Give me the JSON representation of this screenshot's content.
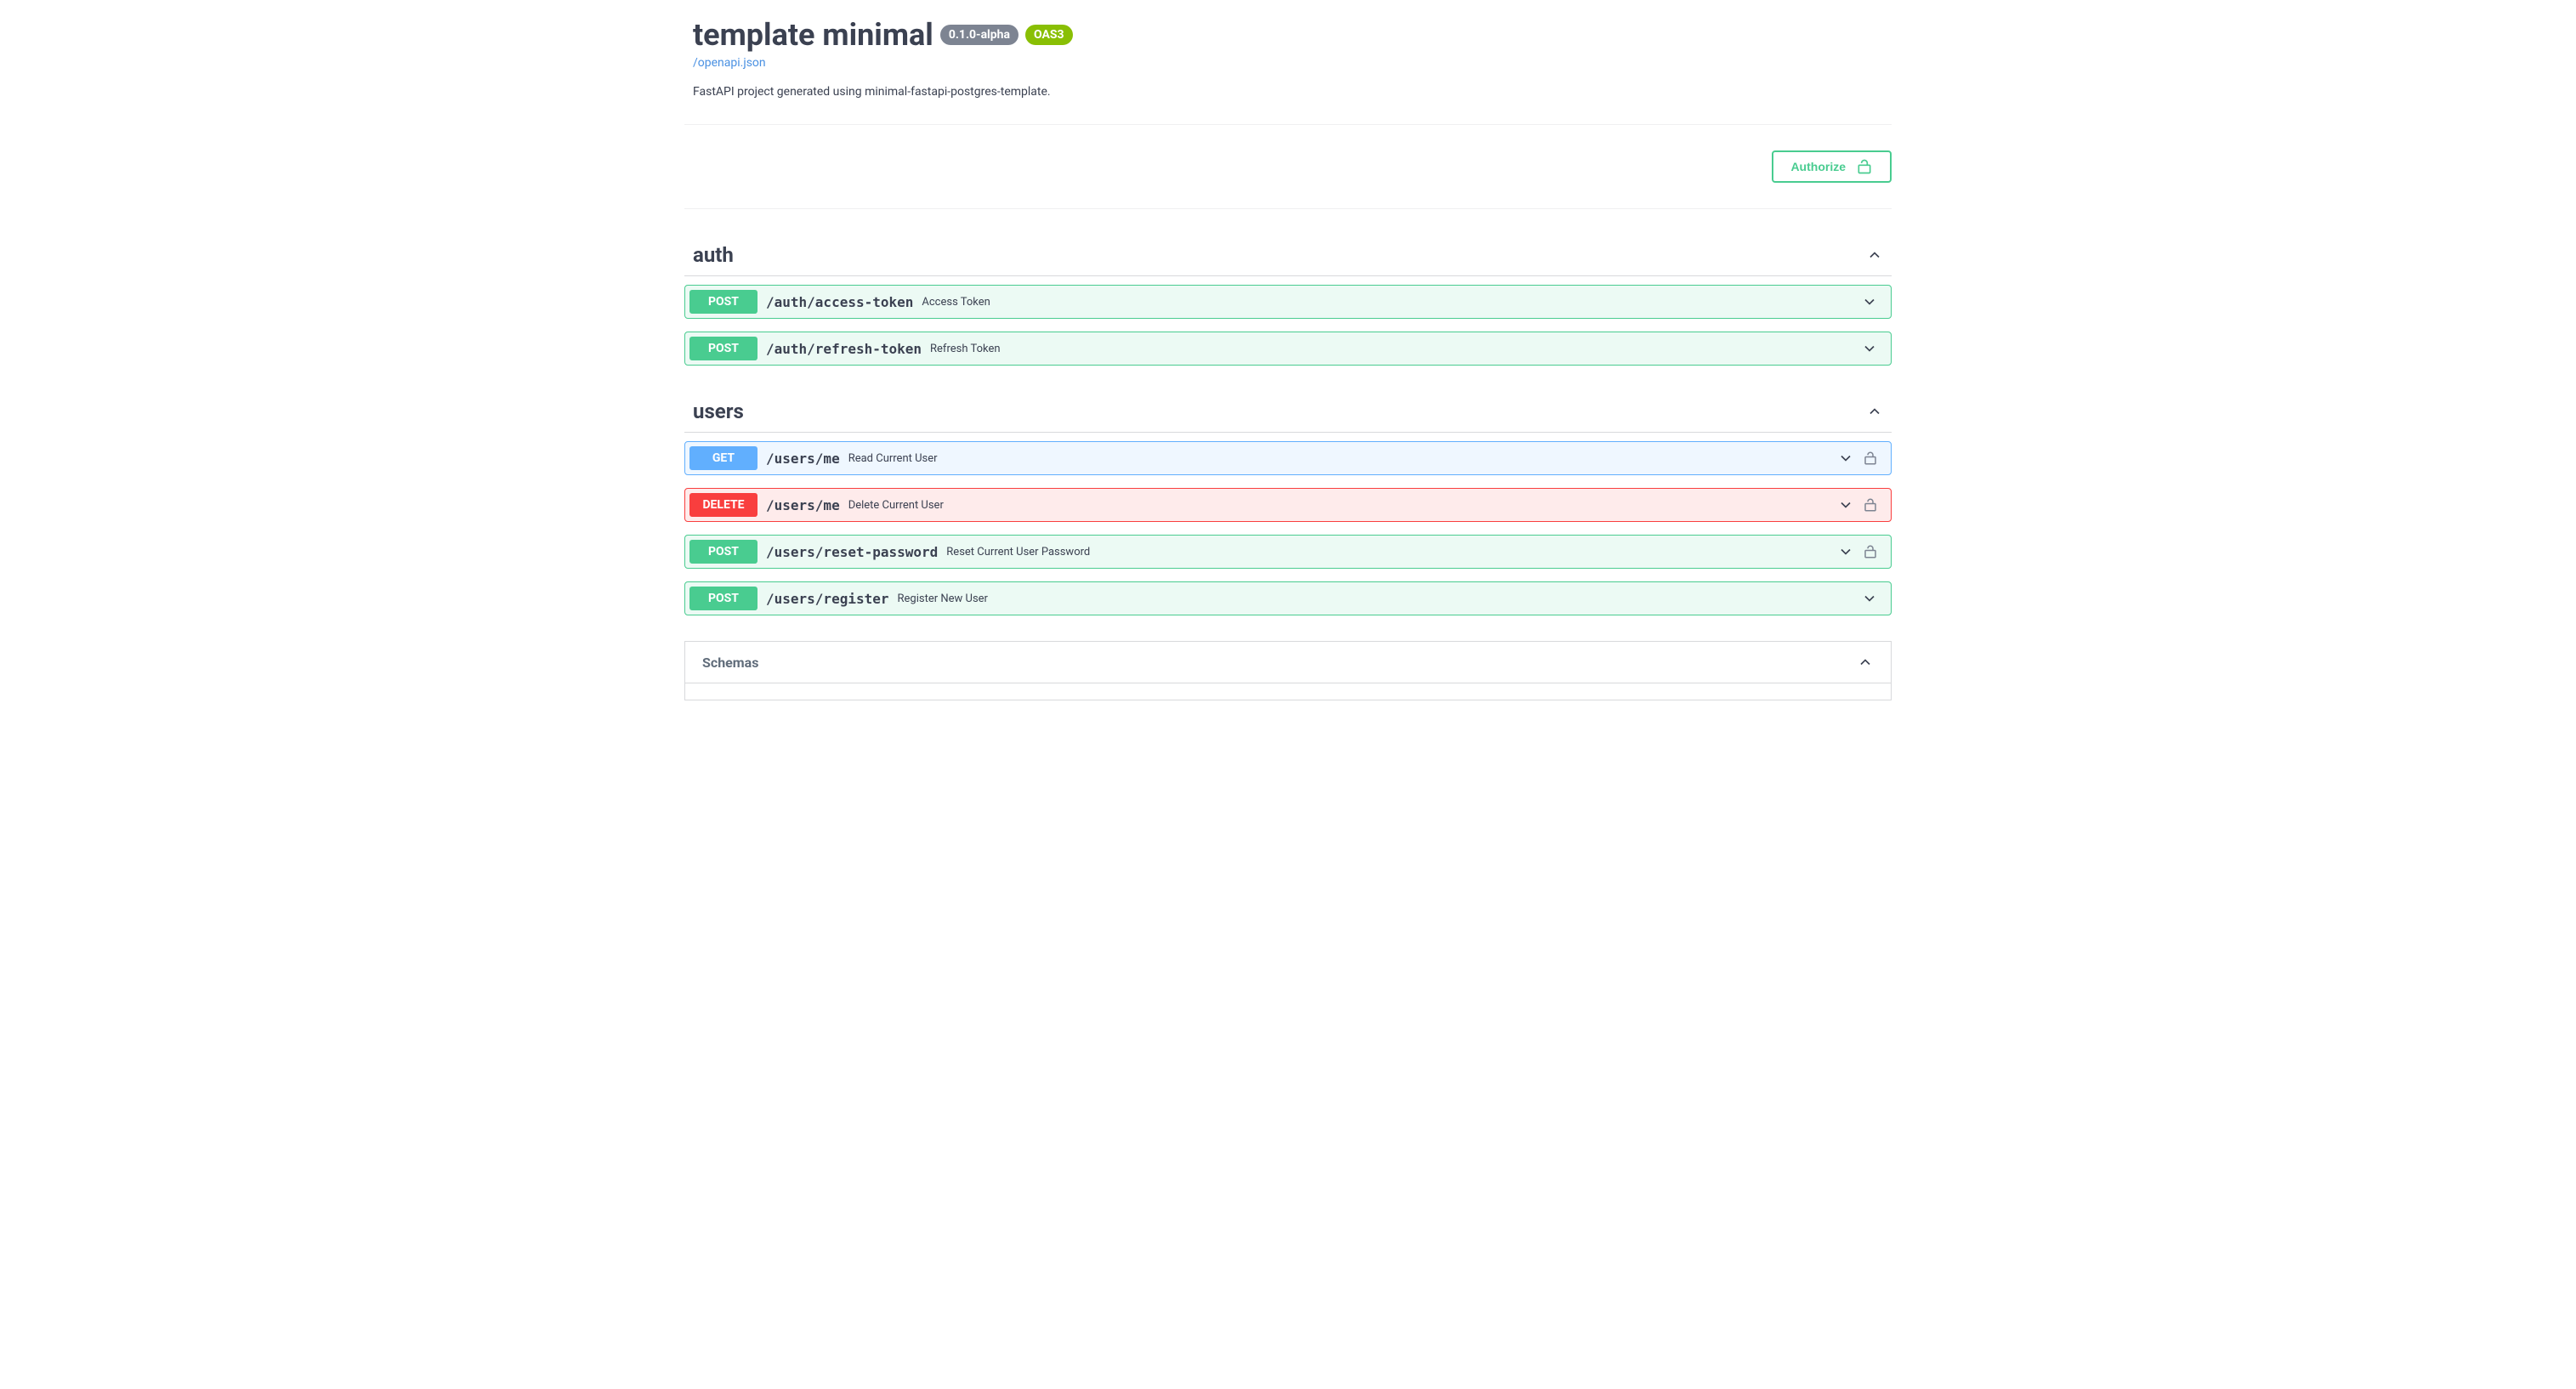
{
  "header": {
    "title": "template minimal",
    "version": "0.1.0-alpha",
    "oas": "OAS3",
    "spec_link": "/openapi.json",
    "description": "FastAPI project generated using minimal-fastapi-postgres-template."
  },
  "authorize": {
    "label": "Authorize"
  },
  "tags": [
    {
      "name": "auth",
      "operations": [
        {
          "method": "POST",
          "method_class": "post",
          "path": "/auth/access-token",
          "summary": "Access Token",
          "lock": false
        },
        {
          "method": "POST",
          "method_class": "post",
          "path": "/auth/refresh-token",
          "summary": "Refresh Token",
          "lock": false
        }
      ]
    },
    {
      "name": "users",
      "operations": [
        {
          "method": "GET",
          "method_class": "get",
          "path": "/users/me",
          "summary": "Read Current User",
          "lock": true
        },
        {
          "method": "DELETE",
          "method_class": "delete",
          "path": "/users/me",
          "summary": "Delete Current User",
          "lock": true
        },
        {
          "method": "POST",
          "method_class": "post",
          "path": "/users/reset-password",
          "summary": "Reset Current User Password",
          "lock": true
        },
        {
          "method": "POST",
          "method_class": "post",
          "path": "/users/register",
          "summary": "Register New User",
          "lock": false
        }
      ]
    }
  ],
  "schemas": {
    "title": "Schemas"
  }
}
